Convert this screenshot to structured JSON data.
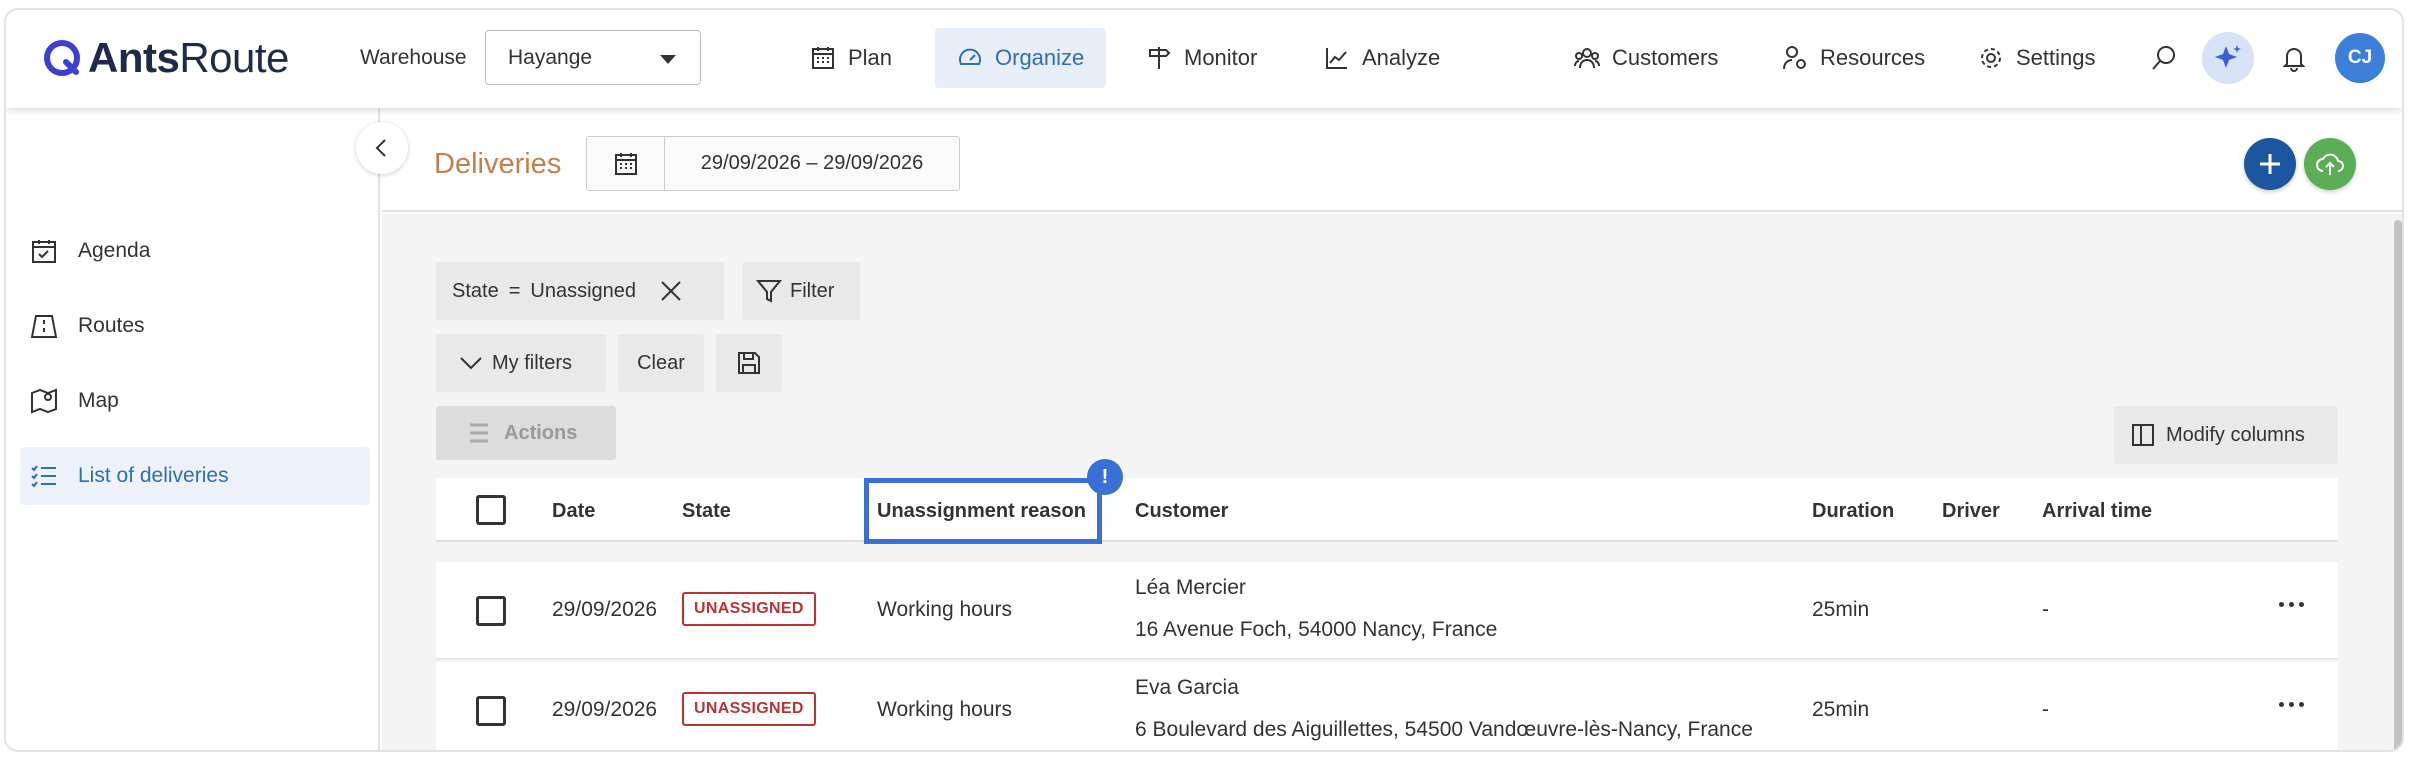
{
  "app": {
    "logo_text_bold": "Ants",
    "logo_text_light": "Route"
  },
  "topbar": {
    "warehouse_label": "Warehouse",
    "warehouse_value": "Hayange",
    "nav": [
      {
        "label": "Plan",
        "icon": "calendar-grid-icon"
      },
      {
        "label": "Organize",
        "icon": "gauge-icon",
        "active": true
      },
      {
        "label": "Monitor",
        "icon": "signpost-icon"
      },
      {
        "label": "Analyze",
        "icon": "chart-icon"
      },
      {
        "label": "Customers",
        "icon": "people-icon"
      },
      {
        "label": "Resources",
        "icon": "person-gear-icon"
      },
      {
        "label": "Settings",
        "icon": "gear-icon"
      }
    ],
    "avatar_initials": "CJ"
  },
  "sidebar": {
    "items": [
      {
        "label": "Agenda",
        "icon": "calendar-check-icon"
      },
      {
        "label": "Routes",
        "icon": "route-icon"
      },
      {
        "label": "Map",
        "icon": "map-pin-icon"
      },
      {
        "label": "List of deliveries",
        "icon": "list-check-icon",
        "active": true
      }
    ]
  },
  "header": {
    "title": "Deliveries",
    "date_range": "29/09/2026 – 29/09/2026"
  },
  "filters": {
    "active_filter_field": "State",
    "active_filter_operator": "=",
    "active_filter_value": "Unassigned",
    "filter_button": "Filter",
    "my_filters_button": "My filters",
    "clear_button": "Clear",
    "actions_button": "Actions",
    "modify_columns_button": "Modify columns"
  },
  "table": {
    "columns": {
      "date": "Date",
      "state": "State",
      "reason": "Unassignment reason",
      "customer": "Customer",
      "duration": "Duration",
      "driver": "Driver",
      "arrival": "Arrival time"
    },
    "highlight_marker": "!",
    "rows": [
      {
        "date": "29/09/2026",
        "state": "UNASSIGNED",
        "reason": "Working hours",
        "customer_name": "Léa Mercier",
        "customer_address": "16 Avenue Foch, 54000 Nancy, France",
        "duration": "25min",
        "driver": "",
        "arrival": "-"
      },
      {
        "date": "29/09/2026",
        "state": "UNASSIGNED",
        "reason": "Working hours",
        "customer_name": "Eva Garcia",
        "customer_address": "6 Boulevard des Aiguillettes, 54500 Vandœuvre-lès-Nancy, France",
        "duration": "25min",
        "driver": "",
        "arrival": "-"
      }
    ]
  },
  "colors": {
    "accent_blue": "#2f6fb3",
    "title_orange": "#c77f4a",
    "state_red": "#b33333",
    "highlight_blue": "#3a6fd8",
    "upload_green": "#5aae55",
    "add_blue": "#1d56a0"
  }
}
